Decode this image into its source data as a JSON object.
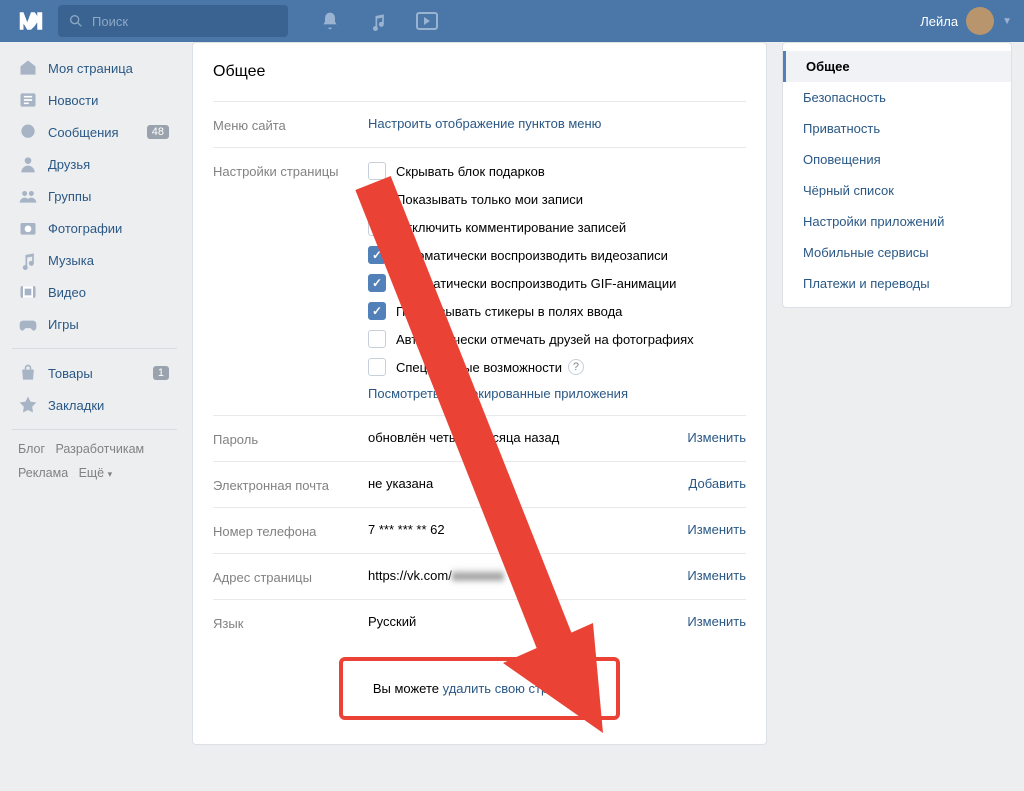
{
  "header": {
    "search_placeholder": "Поиск",
    "username": "Лейла"
  },
  "leftnav": {
    "items": [
      {
        "label": "Моя страница",
        "icon": "home"
      },
      {
        "label": "Новости",
        "icon": "news"
      },
      {
        "label": "Сообщения",
        "icon": "msg",
        "badge": "48"
      },
      {
        "label": "Друзья",
        "icon": "friend"
      },
      {
        "label": "Группы",
        "icon": "groups"
      },
      {
        "label": "Фотографии",
        "icon": "photo"
      },
      {
        "label": "Музыка",
        "icon": "music"
      },
      {
        "label": "Видео",
        "icon": "video"
      },
      {
        "label": "Игры",
        "icon": "games"
      }
    ],
    "items2": [
      {
        "label": "Товары",
        "icon": "market",
        "badge": "1"
      },
      {
        "label": "Закладки",
        "icon": "fav"
      }
    ],
    "footer": {
      "blog": "Блог",
      "dev": "Разработчикам",
      "ads": "Реклама",
      "more": "Ещё"
    }
  },
  "settings": {
    "title": "Общее",
    "menu": {
      "label": "Меню сайта",
      "link": "Настроить отображение пунктов меню"
    },
    "page_settings_label": "Настройки страницы",
    "checkboxes": [
      {
        "label": "Скрывать блок подарков",
        "checked": false
      },
      {
        "label": "Показывать только мои записи",
        "checked": false
      },
      {
        "label": "Отключить комментирование записей",
        "checked": false
      },
      {
        "label": "Автоматически воспроизводить видеозаписи",
        "checked": true
      },
      {
        "label": "Автоматически воспроизводить GIF-анимации",
        "checked": true
      },
      {
        "label": "Подсказывать стикеры в полях ввода",
        "checked": true
      },
      {
        "label": "Автоматически отмечать друзей на фотографиях",
        "checked": false
      },
      {
        "label": "Специальные возможности",
        "checked": false,
        "help": true
      }
    ],
    "blocked_link": "Посмотреть заблокированные приложения",
    "password": {
      "label": "Пароль",
      "value": "обновлён четыре месяца назад",
      "action": "Изменить"
    },
    "email": {
      "label": "Электронная почта",
      "value": "не указана",
      "action": "Добавить"
    },
    "phone": {
      "label": "Номер телефона",
      "value": "7 *** *** ** 62",
      "action": "Изменить"
    },
    "address": {
      "label": "Адрес страницы",
      "value_prefix": "https://vk.com/",
      "action": "Изменить"
    },
    "lang": {
      "label": "Язык",
      "value": "Русский",
      "action": "Изменить"
    },
    "delete": {
      "prefix": "Вы можете ",
      "link": "удалить свою страницу."
    }
  },
  "rightpane": {
    "items": [
      "Общее",
      "Безопасность",
      "Приватность",
      "Оповещения",
      "Чёрный список",
      "Настройки приложений",
      "Мобильные сервисы",
      "Платежи и переводы"
    ],
    "active_index": 0
  }
}
